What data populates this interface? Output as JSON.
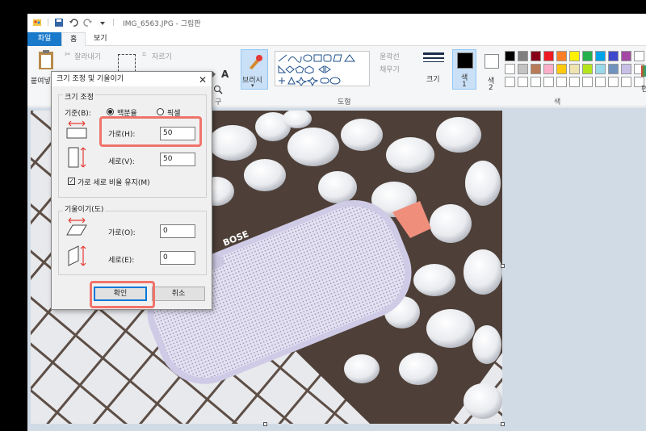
{
  "window": {
    "file_name": "IMG_6563.JPG - 그림판"
  },
  "tabs": [
    {
      "label": "파일"
    },
    {
      "label": "홈"
    },
    {
      "label": "보기"
    }
  ],
  "ribbon": {
    "paste_label": "붙여넣",
    "cut_label": "잘라내기",
    "crop_label": "자르기",
    "resize_label_partial": "크기 조정",
    "brush_label": "브러시",
    "outline_label": "윤곽선",
    "fill_label": "채우기",
    "shapes_group": "도형",
    "size_label": "크기",
    "color1_label": "색\n1",
    "color1_a": "색",
    "color1_b": "1",
    "color2_a": "색",
    "color2_b": "2",
    "colors_group": "색",
    "tools_group": "구",
    "edit_colors_partial": "편"
  },
  "palette": [
    "#000000",
    "#7f7f7f",
    "#880015",
    "#ed1c24",
    "#ff7f27",
    "#fff200",
    "#22b14c",
    "#00a2e8",
    "#3f48cc",
    "#a349a4",
    "#ffffff",
    "#ffffff",
    "#c3c3c3",
    "#b97a57",
    "#ffaec9",
    "#ffc90e",
    "#efe4b0",
    "#b5e61d",
    "#99d9ea",
    "#7092be",
    "#c8bfe7",
    "#ffffff",
    "#ffffff",
    "#ffffff",
    "#ffffff",
    "#ffffff",
    "#ffffff",
    "#ffffff",
    "#ffffff",
    "#ffffff",
    "#ffffff",
    "#ffffff",
    "#ffffff"
  ],
  "dialog": {
    "title": "크기 조정 및 기울이기",
    "resize_section": "크기 조정",
    "basis_label": "기준(B):",
    "percent_label": "백분율",
    "pixel_label": "픽셀",
    "horizontal_label": "가로(H):",
    "horizontal_value": "50",
    "vertical_label": "세로(V):",
    "vertical_value": "50",
    "keep_ratio_label": "가로 세로 비율 유지(M)",
    "skew_section": "기울이기(도)",
    "skew_h_label": "가로(O):",
    "skew_h_value": "0",
    "skew_v_label": "세로(E):",
    "skew_v_value": "0",
    "ok_label": "확인",
    "cancel_label": "취소"
  },
  "colors": {
    "accent": "#1979ca",
    "highlight": "#f0736a",
    "canvas_bg": "#d1dbe6"
  }
}
